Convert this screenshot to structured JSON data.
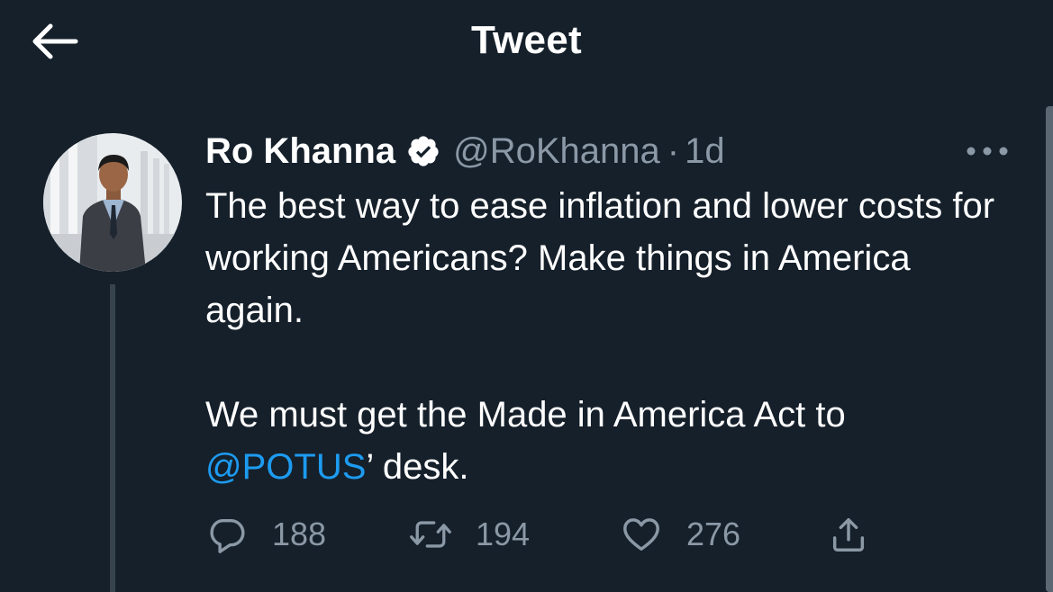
{
  "header": {
    "title": "Tweet",
    "back_icon": "arrow-left-icon"
  },
  "tweet": {
    "author_name": "Ro Khanna",
    "verified_icon": "verified-badge-icon",
    "handle": "@RoKhanna",
    "separator": "·",
    "timestamp": "1d",
    "more_icon": "more-horizontal-icon",
    "text_line1": "The best way to ease inflation and lower costs for working Americans? Make things in America again.",
    "text_line2_before": "We must get the Made in America Act to ",
    "mention": "@POTUS",
    "text_line2_after": "’ desk.",
    "reply_count": "188",
    "retweet_count": "194",
    "like_count": "276"
  },
  "colors": {
    "background": "#15202b",
    "text_primary": "#ffffff",
    "text_secondary": "#8b98a5",
    "accent": "#1d9bf0",
    "thread_line": "#38444d"
  },
  "icons": {
    "reply": "reply-icon",
    "retweet": "retweet-icon",
    "like": "heart-icon",
    "share": "share-icon"
  }
}
